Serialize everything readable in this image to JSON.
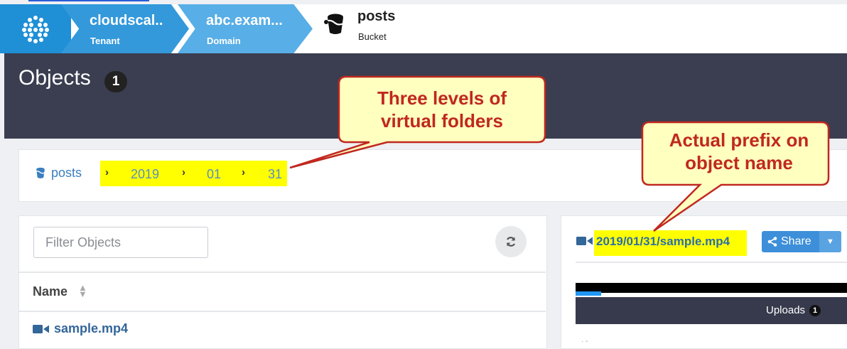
{
  "breadcrumb": {
    "tenant": {
      "title": "cloudscal..",
      "sub": "Tenant"
    },
    "domain": {
      "title": "abc.exam...",
      "sub": "Domain"
    },
    "bucket": {
      "title": "posts",
      "sub": "Bucket"
    }
  },
  "header": {
    "title": "Objects",
    "count": "1"
  },
  "path": {
    "root": "posts",
    "segments": [
      "2019",
      "01",
      "31"
    ]
  },
  "filter": {
    "placeholder": "Filter Objects"
  },
  "table": {
    "column": "Name",
    "rows": [
      {
        "name": "sample.mp4"
      }
    ]
  },
  "detail": {
    "object_name": "2019/01/31/sample.mp4",
    "share_label": "Share",
    "uploads_label": "Uploads",
    "uploads_count": "1"
  },
  "callouts": {
    "folders": "Three levels of virtual folders",
    "prefix": "Actual prefix on object name"
  },
  "colors": {
    "highlight": "#ffff00",
    "callout_fill": "#ffffc0",
    "callout_text": "#c0281f",
    "accent": "#3d8fd9"
  },
  "icons": [
    "logo-icon",
    "bucket-icon",
    "video-icon",
    "refresh-icon",
    "share-icon",
    "sort-icon",
    "chevron-right-icon",
    "caret-down-icon"
  ]
}
